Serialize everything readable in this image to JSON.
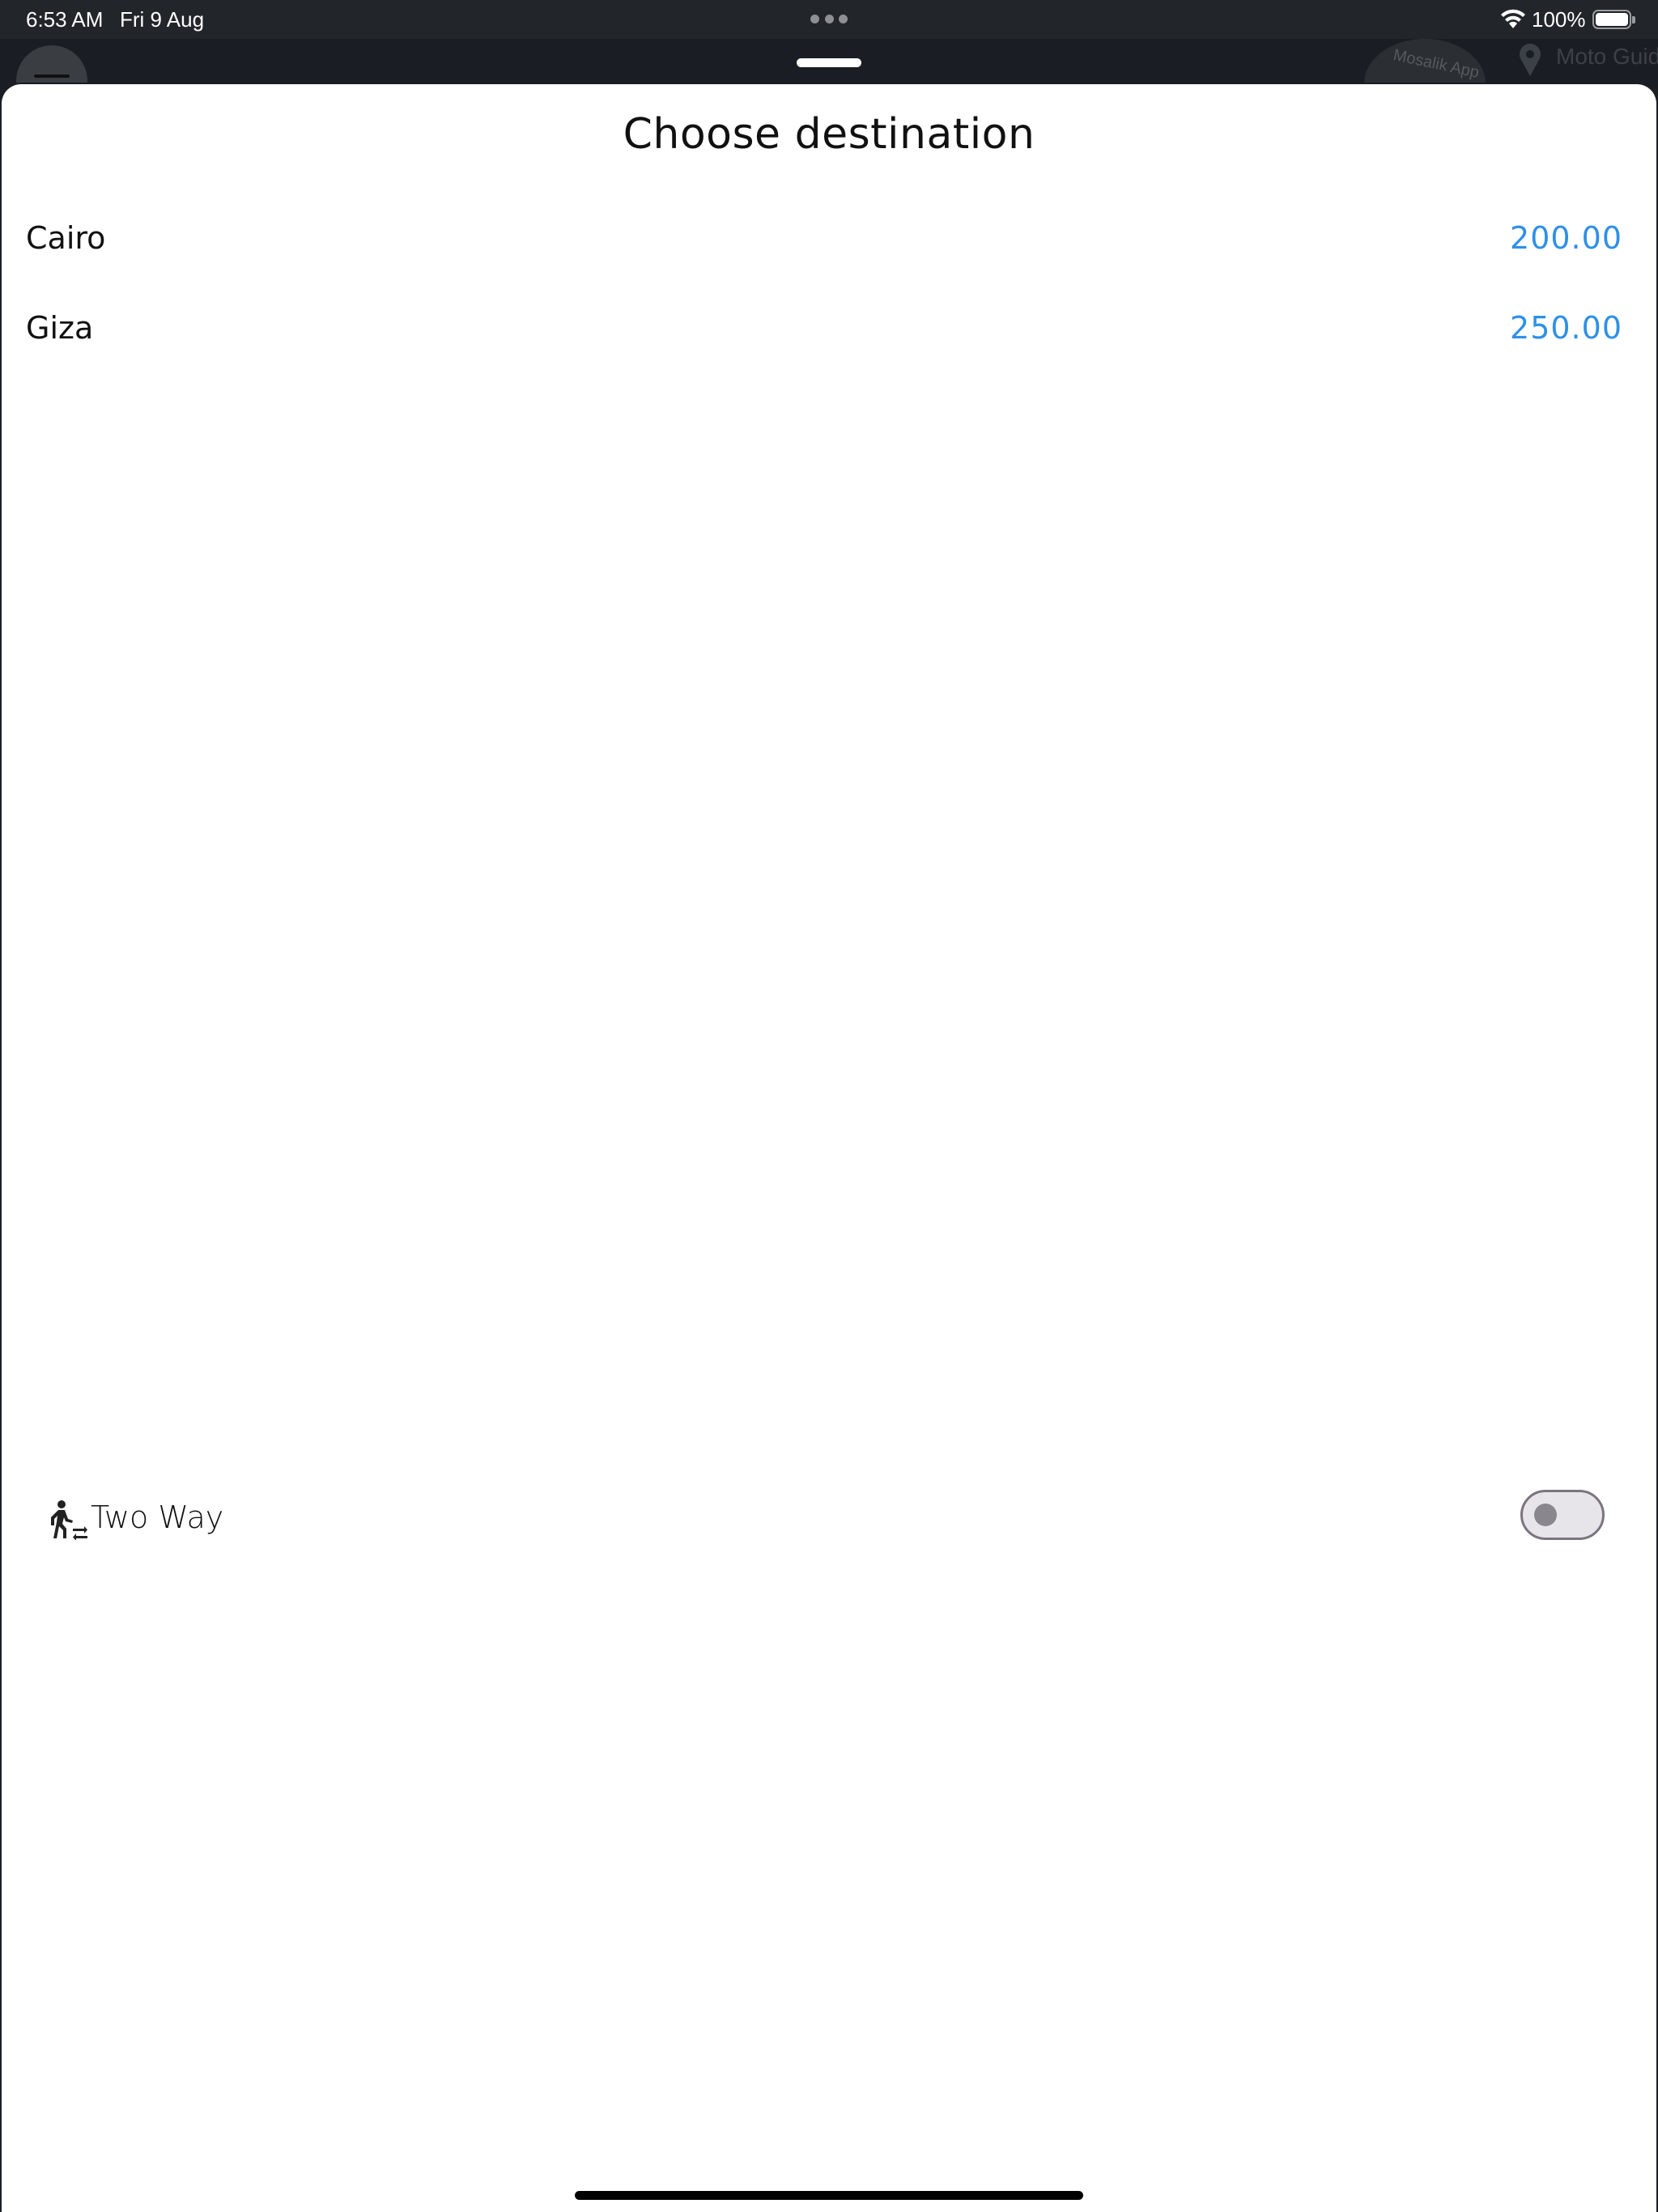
{
  "status_bar": {
    "time": "6:53 AM",
    "date": "Fri 9 Aug",
    "battery_percent": "100%",
    "icons": [
      "wifi-icon",
      "battery-icon",
      "multitasking-dots-icon"
    ]
  },
  "background_app": {
    "brand_text": "Moto Guid",
    "logo_text": "Mosalik App"
  },
  "sheet": {
    "title": "Choose destination",
    "destinations": [
      {
        "name": "Cairo",
        "price": "200.00"
      },
      {
        "name": "Giza",
        "price": "250.00"
      }
    ],
    "two_way": {
      "label": "Two Way",
      "icon": "walk-two-way-icon",
      "enabled": false
    }
  },
  "colors": {
    "price": "#2f90e6",
    "status_bar_bg": "#22252a",
    "sheet_bg": "#ffffff",
    "toggle_track": "#e8e5ea",
    "toggle_border": "#7a757e"
  }
}
